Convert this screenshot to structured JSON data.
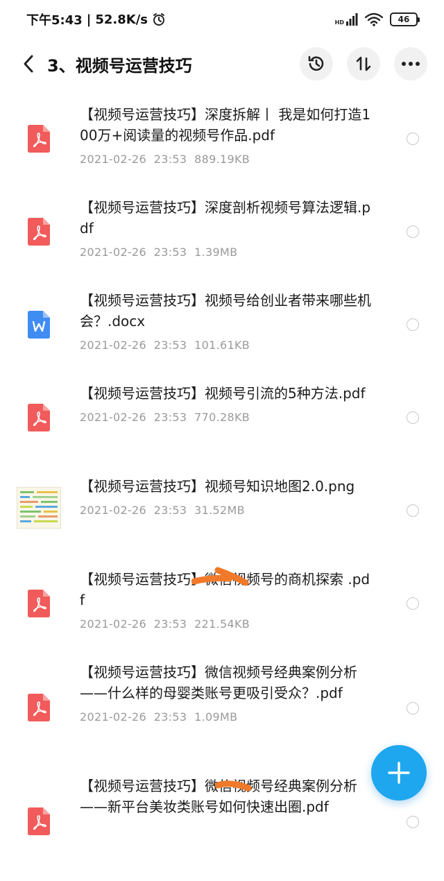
{
  "status_bar": {
    "time": "下午5:43",
    "separator": "|",
    "net_speed": "52.8K/s",
    "network_label": "HD",
    "battery": "46"
  },
  "header": {
    "title": "3、视频号运营技巧"
  },
  "files": [
    {
      "name": "【视频号运营技巧】深度拆解丨 我是如何打造100万+阅读量的视频号作品.pdf",
      "date": "2021-02-26",
      "time": "23:53",
      "size": "889.19KB",
      "type": "pdf"
    },
    {
      "name": "【视频号运营技巧】深度剖析视频号算法逻辑.pdf",
      "date": "2021-02-26",
      "time": "23:53",
      "size": "1.39MB",
      "type": "pdf"
    },
    {
      "name": "【视频号运营技巧】视频号给创业者带来哪些机会？.docx",
      "date": "2021-02-26",
      "time": "23:53",
      "size": "101.61KB",
      "type": "docx"
    },
    {
      "name": "【视频号运营技巧】视频号引流的5种方法.pdf",
      "date": "2021-02-26",
      "time": "23:53",
      "size": "770.28KB",
      "type": "pdf"
    },
    {
      "name": "【视频号运营技巧】视频号知识地图2.0.png",
      "date": "2021-02-26",
      "time": "23:53",
      "size": "31.52MB",
      "type": "png"
    },
    {
      "name": "【视频号运营技巧】微信视频号的商机探索 .pdf",
      "date": "2021-02-26",
      "time": "23:53",
      "size": "221.54KB",
      "type": "pdf"
    },
    {
      "name": "【视频号运营技巧】微信视频号经典案例分析——什么样的母婴类账号更吸引受众？.pdf",
      "date": "2021-02-26",
      "time": "23:53",
      "size": "1.09MB",
      "type": "pdf"
    },
    {
      "name": "【视频号运营技巧】微信视频号经典案例分析——新平台美妆类账号如何快速出圈.pdf",
      "date": "",
      "time": "",
      "size": "",
      "type": "pdf"
    }
  ],
  "colors": {
    "pdf_red": "#f15b5b",
    "docx_blue": "#3f8cf3",
    "fab_blue": "#1ea7ee",
    "scribble_orange": "#f07a2a"
  },
  "icons": {
    "back": "back-arrow-icon",
    "history": "history-icon",
    "sort": "sort-icon",
    "more": "more-icon",
    "add": "plus-icon"
  }
}
